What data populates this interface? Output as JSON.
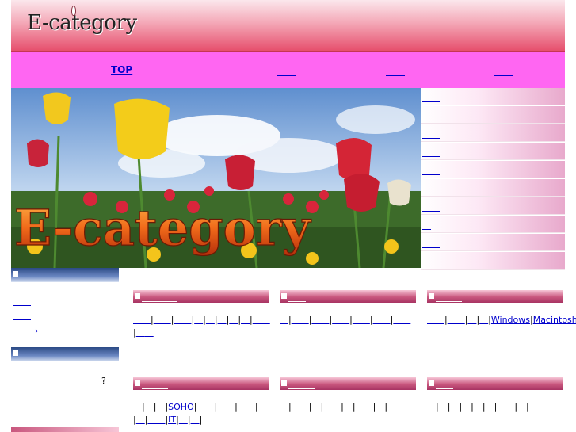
{
  "site": {
    "logo_text": "E-category"
  },
  "nav": {
    "items": [
      "TOP",
      "　　",
      "　　",
      "　　"
    ]
  },
  "banner": {
    "title": "E-category"
  },
  "side_menu": {
    "items": [
      "　　",
      "　",
      "　　",
      "　　",
      "　　",
      "　　",
      "　　",
      "　",
      "　　",
      "　　"
    ]
  },
  "left": {
    "links": [
      "　　",
      "　　",
      "　　→"
    ],
    "question": "?"
  },
  "categories": [
    {
      "title": "　　　　",
      "body": [
        "　　",
        "|",
        "　　",
        "|",
        "　　",
        "|",
        "　",
        "|",
        "　",
        "|",
        "　",
        "|",
        "　",
        "|",
        "　",
        "|",
        "　　",
        "|",
        "　",
        "　"
      ]
    },
    {
      "title": "　　",
      "body": [
        "　",
        "|",
        "　　",
        "|",
        "　　",
        "|",
        "　　",
        "|",
        "　　",
        "|",
        "　　",
        "|",
        "　　"
      ]
    },
    {
      "title": "　　　",
      "body": [
        "　　",
        "|",
        "　　",
        "|",
        "　",
        "|",
        "　",
        "|",
        "Windows",
        "|",
        "Macintosh"
      ]
    },
    {
      "title": "　　　",
      "body": [
        "　",
        "|",
        "　",
        "|",
        "　",
        "|",
        "SOHO",
        "|",
        "　　",
        "|",
        "　　",
        "|",
        "　　",
        "|",
        "　　",
        "|",
        "　",
        "|",
        "　　",
        "|",
        "IT",
        "|",
        "　",
        "|",
        "　",
        "|"
      ]
    },
    {
      "title": "　　　",
      "body": [
        "　",
        "|",
        "　　",
        "|",
        "　",
        "|",
        "　　",
        "|",
        "　",
        "|",
        "　　",
        "|",
        "　",
        "|",
        "　　"
      ]
    },
    {
      "title": "　　",
      "body": [
        "　",
        "|",
        "　",
        "|",
        "　",
        "|",
        "　",
        "|",
        "　",
        "|",
        "　",
        "|",
        "　　",
        "|",
        "　",
        "|",
        "　"
      ]
    }
  ],
  "colors": {
    "nav_bg": "#ff66f2",
    "header_red": "#e64f6d",
    "link": "#0000cc"
  }
}
